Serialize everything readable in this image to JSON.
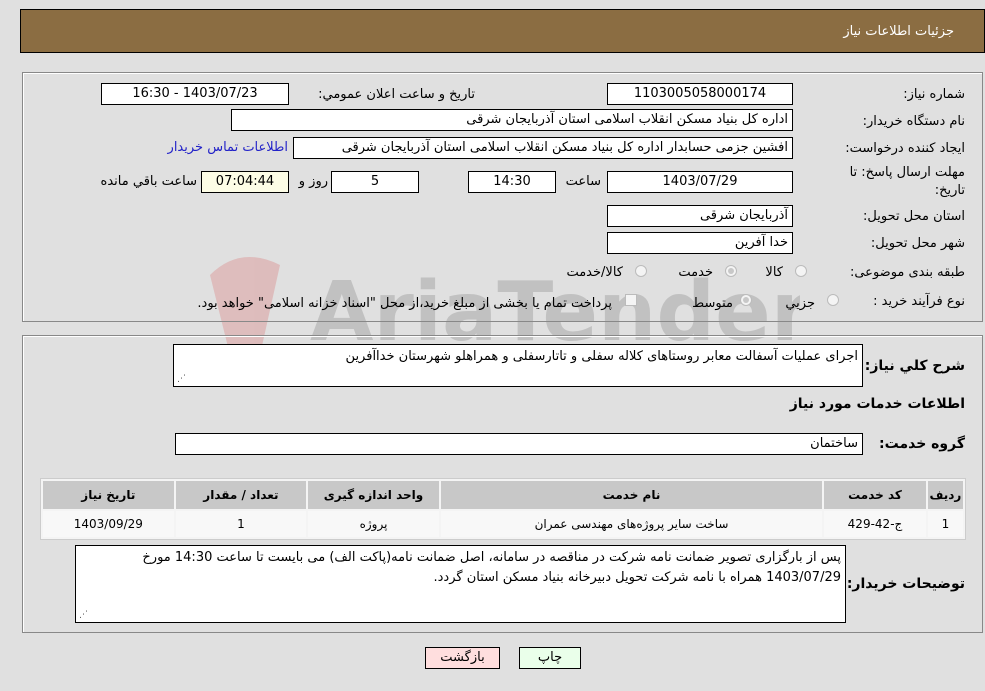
{
  "header": {
    "title": "جزئيات اطلاعات نياز"
  },
  "details": {
    "need_number": {
      "label": "شماره نياز:",
      "value": "1103005058000174"
    },
    "announce": {
      "label": "تاريخ و ساعت اعلان عمومي:",
      "value": "1403/07/23 - 16:30"
    },
    "buyer_org": {
      "label": "نام دستگاه خريدار:",
      "value": "اداره کل بنیاد مسکن انقلاب اسلامی استان آذربایجان شرقی"
    },
    "creator": {
      "label": "ايجاد کننده درخواست:",
      "value": "افشین جزمی حسابدار اداره کل بنیاد مسکن انقلاب اسلامی استان آذربایجان شرقی",
      "contact_link": "اطلاعات تماس خريدار"
    },
    "deadline": {
      "label_line1": "مهلت ارسال پاسخ: تا",
      "label_line2": "تاريخ:",
      "date": "1403/07/29",
      "time_label": "ساعت",
      "time": "14:30",
      "days": "5",
      "days_label": "روز و",
      "remaining": "07:04:44",
      "remaining_label": "ساعت باقي مانده"
    },
    "province": {
      "label": "استان محل تحويل:",
      "value": "آذربایجان شرقی"
    },
    "city": {
      "label": "شهر محل تحويل:",
      "value": "خدا آفرین"
    },
    "category": {
      "label": "طبقه بندی موضوعی:",
      "options": [
        {
          "label": "کالا",
          "checked": false
        },
        {
          "label": "خدمت",
          "checked": true
        },
        {
          "label": "کالا/خدمت",
          "checked": false
        }
      ]
    },
    "process": {
      "label": "نوع فرآیند خرید :",
      "options": [
        {
          "label": "جزيي",
          "checked": false
        },
        {
          "label": "متوسط",
          "checked": true
        }
      ],
      "treasury_checkbox_label": "پرداخت تمام يا بخشی از مبلغ خريد،از محل \"اسناد خزانه اسلامی\" خواهد بود.",
      "treasury_checked": false
    }
  },
  "description": {
    "label": "شرح کلي نياز:",
    "value": "اجرای عملیات آسفالت معابر روستاهای کلاله سفلی و تاتارسفلی و همراهلو شهرستان خداآفرین"
  },
  "services_section_title": "اطلاعات خدمات مورد نياز",
  "service_group": {
    "label": "گروه خدمت:",
    "value": "ساختمان"
  },
  "table": {
    "headers": [
      "رديف",
      "کد خدمت",
      "نام خدمت",
      "واحد اندازه گيری",
      "تعداد / مقدار",
      "تاريخ نياز"
    ],
    "rows": [
      [
        "1",
        "ج-42-429",
        "ساخت سایر پروژه‌های مهندسی عمران",
        "پروژه",
        "1",
        "1403/09/29"
      ]
    ]
  },
  "buyer_notes": {
    "label": "توضيحات خريدار:",
    "value": "پس از بارگزاری تصویر ضمانت نامه شرکت در مناقصه در سامانه، اصل ضمانت نامه(پاکت الف) می بایست تا ساعت 14:30 مورخ  1403/07/29 همراه با نامه شرکت تحویل دبیرخانه بنیاد مسکن استان گردد."
  },
  "buttons": {
    "print": "چاپ",
    "back": "بازگشت"
  },
  "watermark": {
    "text": "AriaTender.neT"
  }
}
